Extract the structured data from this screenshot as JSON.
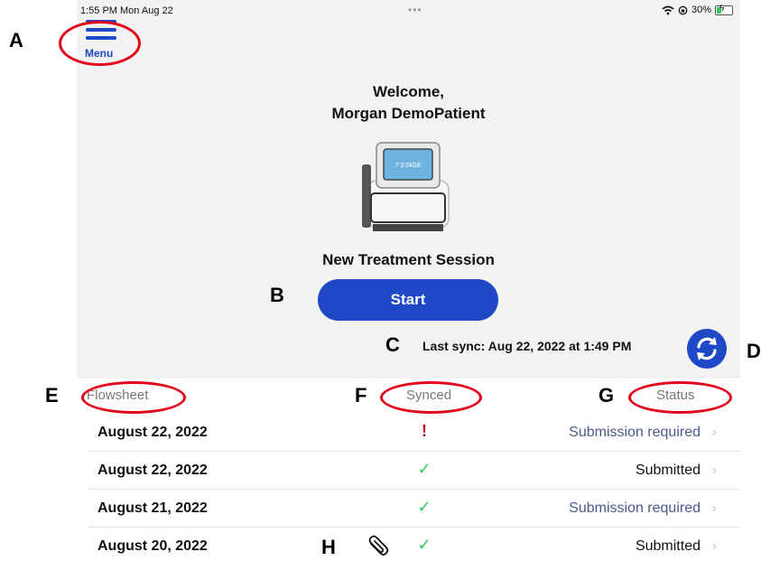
{
  "status_bar": {
    "time": "1:55 PM  Mon Aug 22",
    "dots": "•••",
    "right": "30%"
  },
  "menu": {
    "label": "Menu"
  },
  "welcome": {
    "line1": "Welcome,",
    "line2": "Morgan DemoPatient"
  },
  "device": {
    "screen_label": "7 STAGE"
  },
  "session": {
    "title": "New Treatment Session",
    "start_label": "Start"
  },
  "sync": {
    "text": "Last sync: Aug 22, 2022 at 1:49 PM"
  },
  "table": {
    "headers": {
      "flowsheet": "Flowsheet",
      "synced": "Synced",
      "status": "Status"
    },
    "rows": [
      {
        "date": "August 22, 2022",
        "synced": "!",
        "status": "Submission required",
        "attachment": false
      },
      {
        "date": "August 22, 2022",
        "synced": "✓",
        "status": "Submitted",
        "attachment": false
      },
      {
        "date": "August 21, 2022",
        "synced": "✓",
        "status": "Submission required",
        "attachment": false
      },
      {
        "date": "August 20, 2022",
        "synced": "✓",
        "status": "Submitted",
        "attachment": true
      }
    ]
  },
  "annotations": {
    "A": "A",
    "B": "B",
    "C": "C",
    "D": "D",
    "E": "E",
    "F": "F",
    "G": "G",
    "H": "H"
  },
  "colors": {
    "brand_blue": "#1f48c6",
    "link_status": "#4a5a8c",
    "check_green": "#34c759",
    "alert_red": "#d0021b",
    "annotation_red": "#e2001a"
  }
}
